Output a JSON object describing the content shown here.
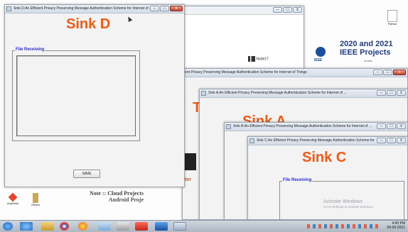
{
  "desktop": {
    "icons": [
      {
        "name": "python-icon",
        "label": "Python"
      },
      {
        "name": "anydesk-icon",
        "label": "AnyDesk"
      },
      {
        "name": "folder-icon",
        "label": "Others"
      }
    ],
    "banner": {
      "line1": "2020 and 2021",
      "line2": "IEEE Projects",
      "ieee": "IEEE",
      "node": "Node17",
      "ieee_tag": "IEEE",
      "globe_label": "GLOBAL"
    },
    "note": {
      "line1": "Note :: Cloud Projects",
      "line2": "Android Proje",
      "partial": "Android Pro",
      "partial2": "ter"
    },
    "activate": {
      "line1": "Activate Windows",
      "line2": "Go to Settings to activate Windows."
    }
  },
  "windows": {
    "sink_d": {
      "title": "Sink D:An Efficient Privacy Preserving Message Authentication Scheme for Internet of ...",
      "heading": "Sink D",
      "group_label": "File Receiving",
      "save_label": "SAVE"
    },
    "main_bg": {
      "title": "ient Privacy Preserving Message Authentication Scheme for Internet of Things"
    },
    "sink_a": {
      "title": "Sink A:An Efficient Privacy Preserving Message Authentication Scheme for Internet of ...",
      "heading": "Sink A",
      "t_letter": "T"
    },
    "sink_b": {
      "title": "Sink B:An Efficient Privacy Preserving Message Authentication Scheme for Internet of ..."
    },
    "sink_c": {
      "title": "Sink C:An Efficient Privacy Preserving Message Authentication Scheme for Internet of ...",
      "heading": "Sink C",
      "group_label": "File Receiving"
    }
  },
  "controls": {
    "minimize": "–",
    "maximize": "□",
    "close": "x"
  },
  "taskbar": {
    "time": "4:45 PM",
    "date": "09-03-2021"
  }
}
